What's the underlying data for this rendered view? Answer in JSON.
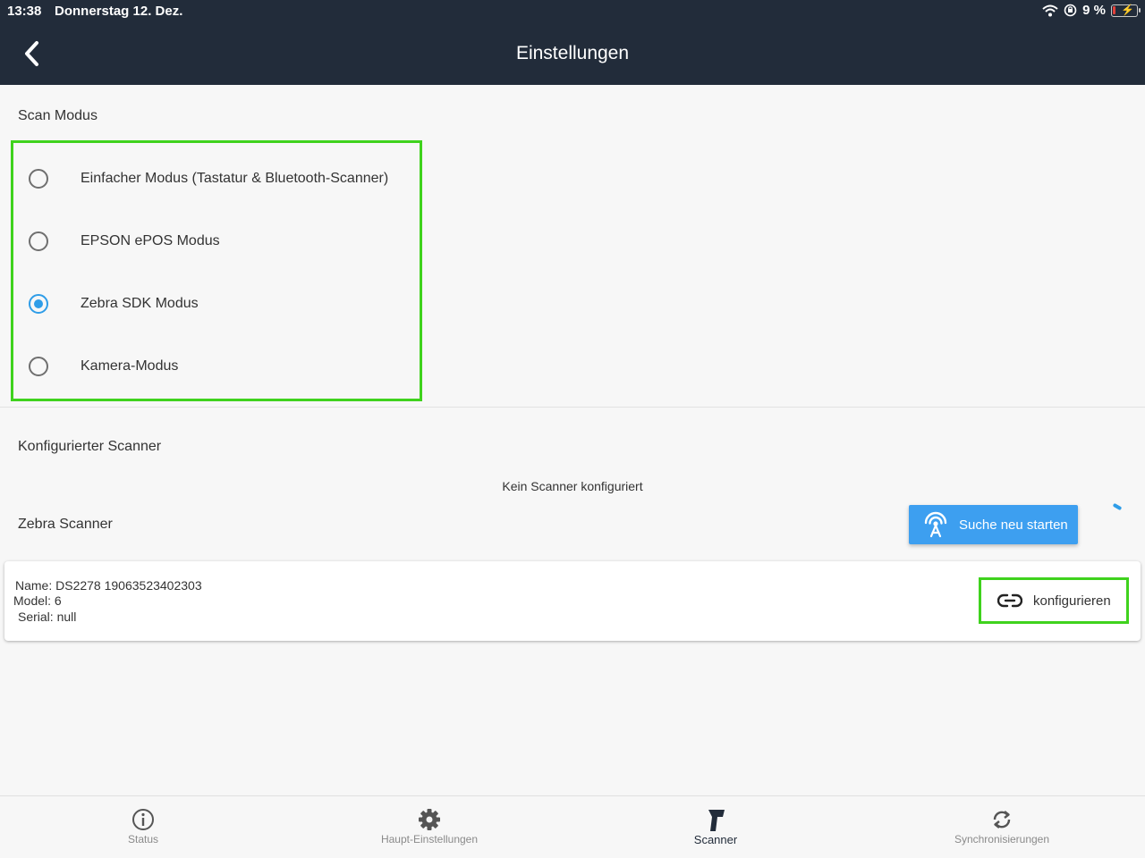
{
  "status_bar": {
    "time": "13:38",
    "date": "Donnerstag 12. Dez.",
    "battery": "9 %"
  },
  "header": {
    "title": "Einstellungen"
  },
  "scan_mode": {
    "label": "Scan Modus",
    "options": [
      {
        "label": "Einfacher Modus (Tastatur & Bluetooth-Scanner)",
        "selected": false
      },
      {
        "label": "EPSON ePOS Modus",
        "selected": false
      },
      {
        "label": "Zebra SDK Modus",
        "selected": true
      },
      {
        "label": "Kamera-Modus",
        "selected": false
      }
    ]
  },
  "configured_scanner": {
    "label": "Konfigurierter Scanner",
    "empty_message": "Kein Scanner konfiguriert"
  },
  "zebra": {
    "label": "Zebra Scanner",
    "search_button": "Suche neu starten",
    "device": {
      "name": "Name: DS2278 19063523402303",
      "model": "Model: 6",
      "serial": "Serial: null"
    },
    "configure_button": "konfigurieren"
  },
  "tabs": [
    {
      "label": "Status",
      "icon": "info-icon",
      "active": false
    },
    {
      "label": "Haupt-Einstellungen",
      "icon": "gear-icon",
      "active": false
    },
    {
      "label": "Scanner",
      "icon": "scanner-icon",
      "active": true
    },
    {
      "label": "Synchronisierungen",
      "icon": "sync-icon",
      "active": false
    }
  ],
  "colors": {
    "header_bg": "#222c3a",
    "accent": "#3d9ff0",
    "highlight": "#3fd21d"
  }
}
